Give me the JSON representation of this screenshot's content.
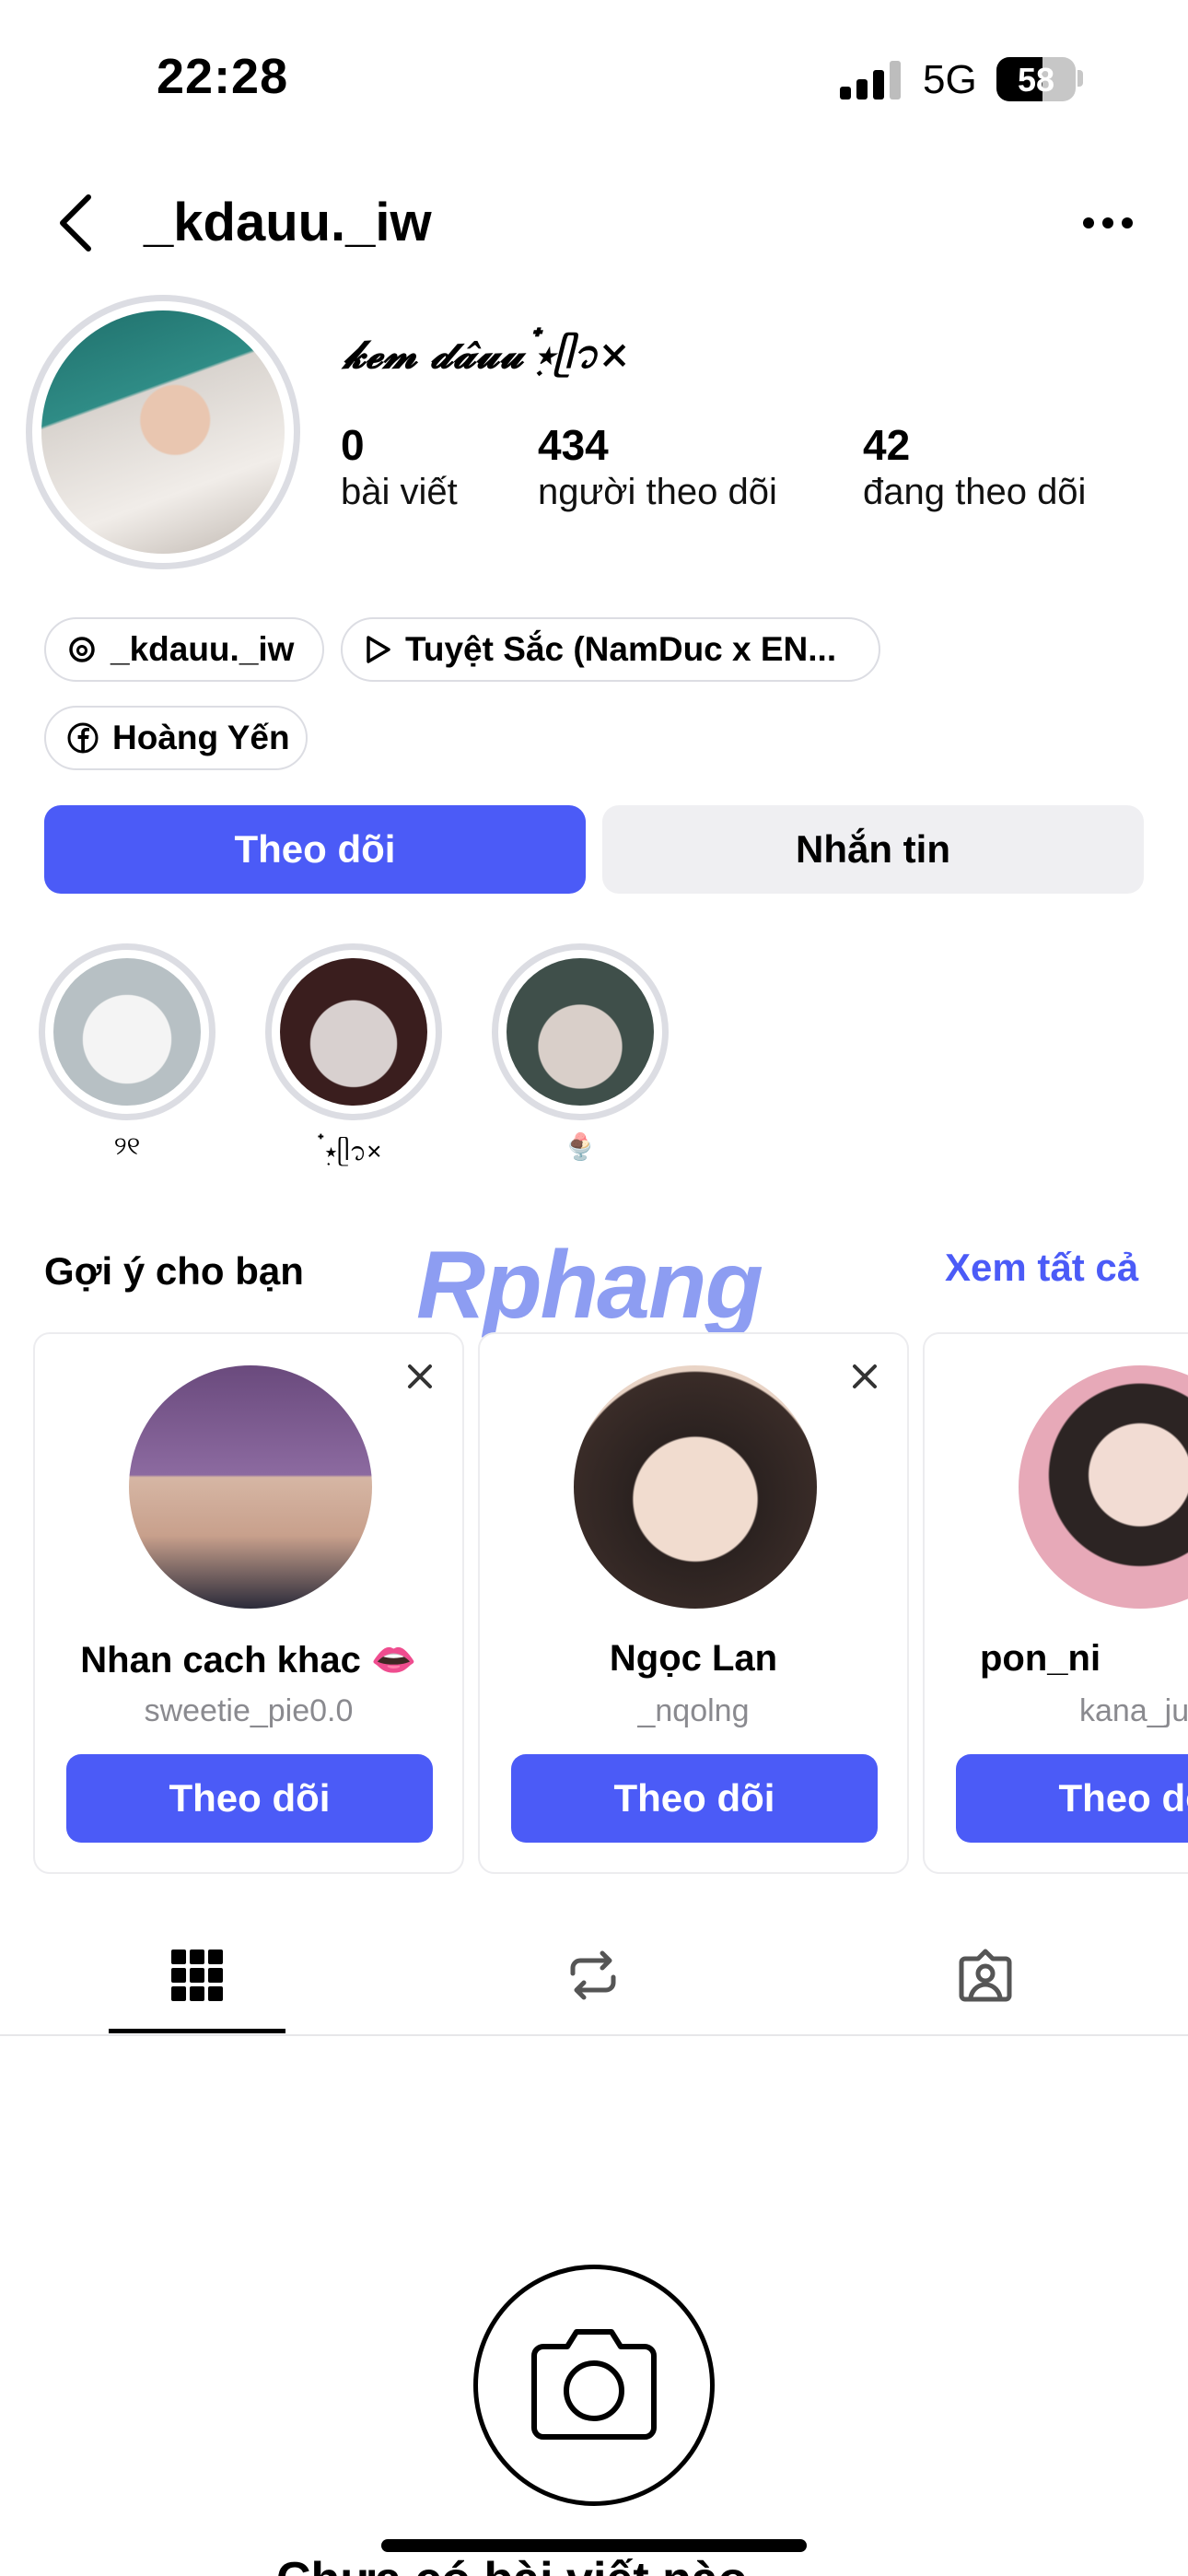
{
  "status_bar": {
    "time": "22:28",
    "network": "5G",
    "battery": "58"
  },
  "header": {
    "username": "_kdauu._iw"
  },
  "profile": {
    "display_name": "𝓴𝓮𝓶 𝓭𝓪̂𝓾𝓾 ๋࣭⭑ᥫ᭡×",
    "stats": [
      {
        "value": "0",
        "label": "bài viết"
      },
      {
        "value": "434",
        "label": "người theo dõi"
      },
      {
        "value": "42",
        "label": "đang theo dõi"
      }
    ]
  },
  "links": {
    "threads": "_kdauu._iw",
    "music": "Tuyệt Sắc (NamDuc x EN...",
    "facebook": "Hoàng Yến"
  },
  "actions": {
    "follow": "Theo dõi",
    "message": "Nhắn tin"
  },
  "highlights": [
    {
      "label": "୨୧",
      "bg": "#a9b4b8"
    },
    {
      "label": "๋࣭⭑ᥫ᭡×",
      "bg": "#3a1e1e"
    },
    {
      "label": "🍨",
      "bg": "#3f4f4a"
    }
  ],
  "suggestions": {
    "title": "Gợi ý cho bạn",
    "see_all": "Xem tất cả",
    "watermark": "Rphang",
    "cards": [
      {
        "name": "Nhan cach khac 👄",
        "handle": "sweetie_pie0.0",
        "button": "Theo dõi"
      },
      {
        "name": "Ngọc Lan",
        "handle": "_nqolng",
        "button": "Theo dõi"
      },
      {
        "name": "pon_ni",
        "handle": "kana_ju",
        "button": "Theo dõi"
      }
    ]
  },
  "tabs": [
    "grid-icon",
    "repost-icon",
    "tagged-icon"
  ],
  "empty_state": {
    "text": "Chưa có bài viết nào"
  },
  "colors": {
    "accent": "#4b5bf7",
    "ring": "#dcdde3"
  }
}
